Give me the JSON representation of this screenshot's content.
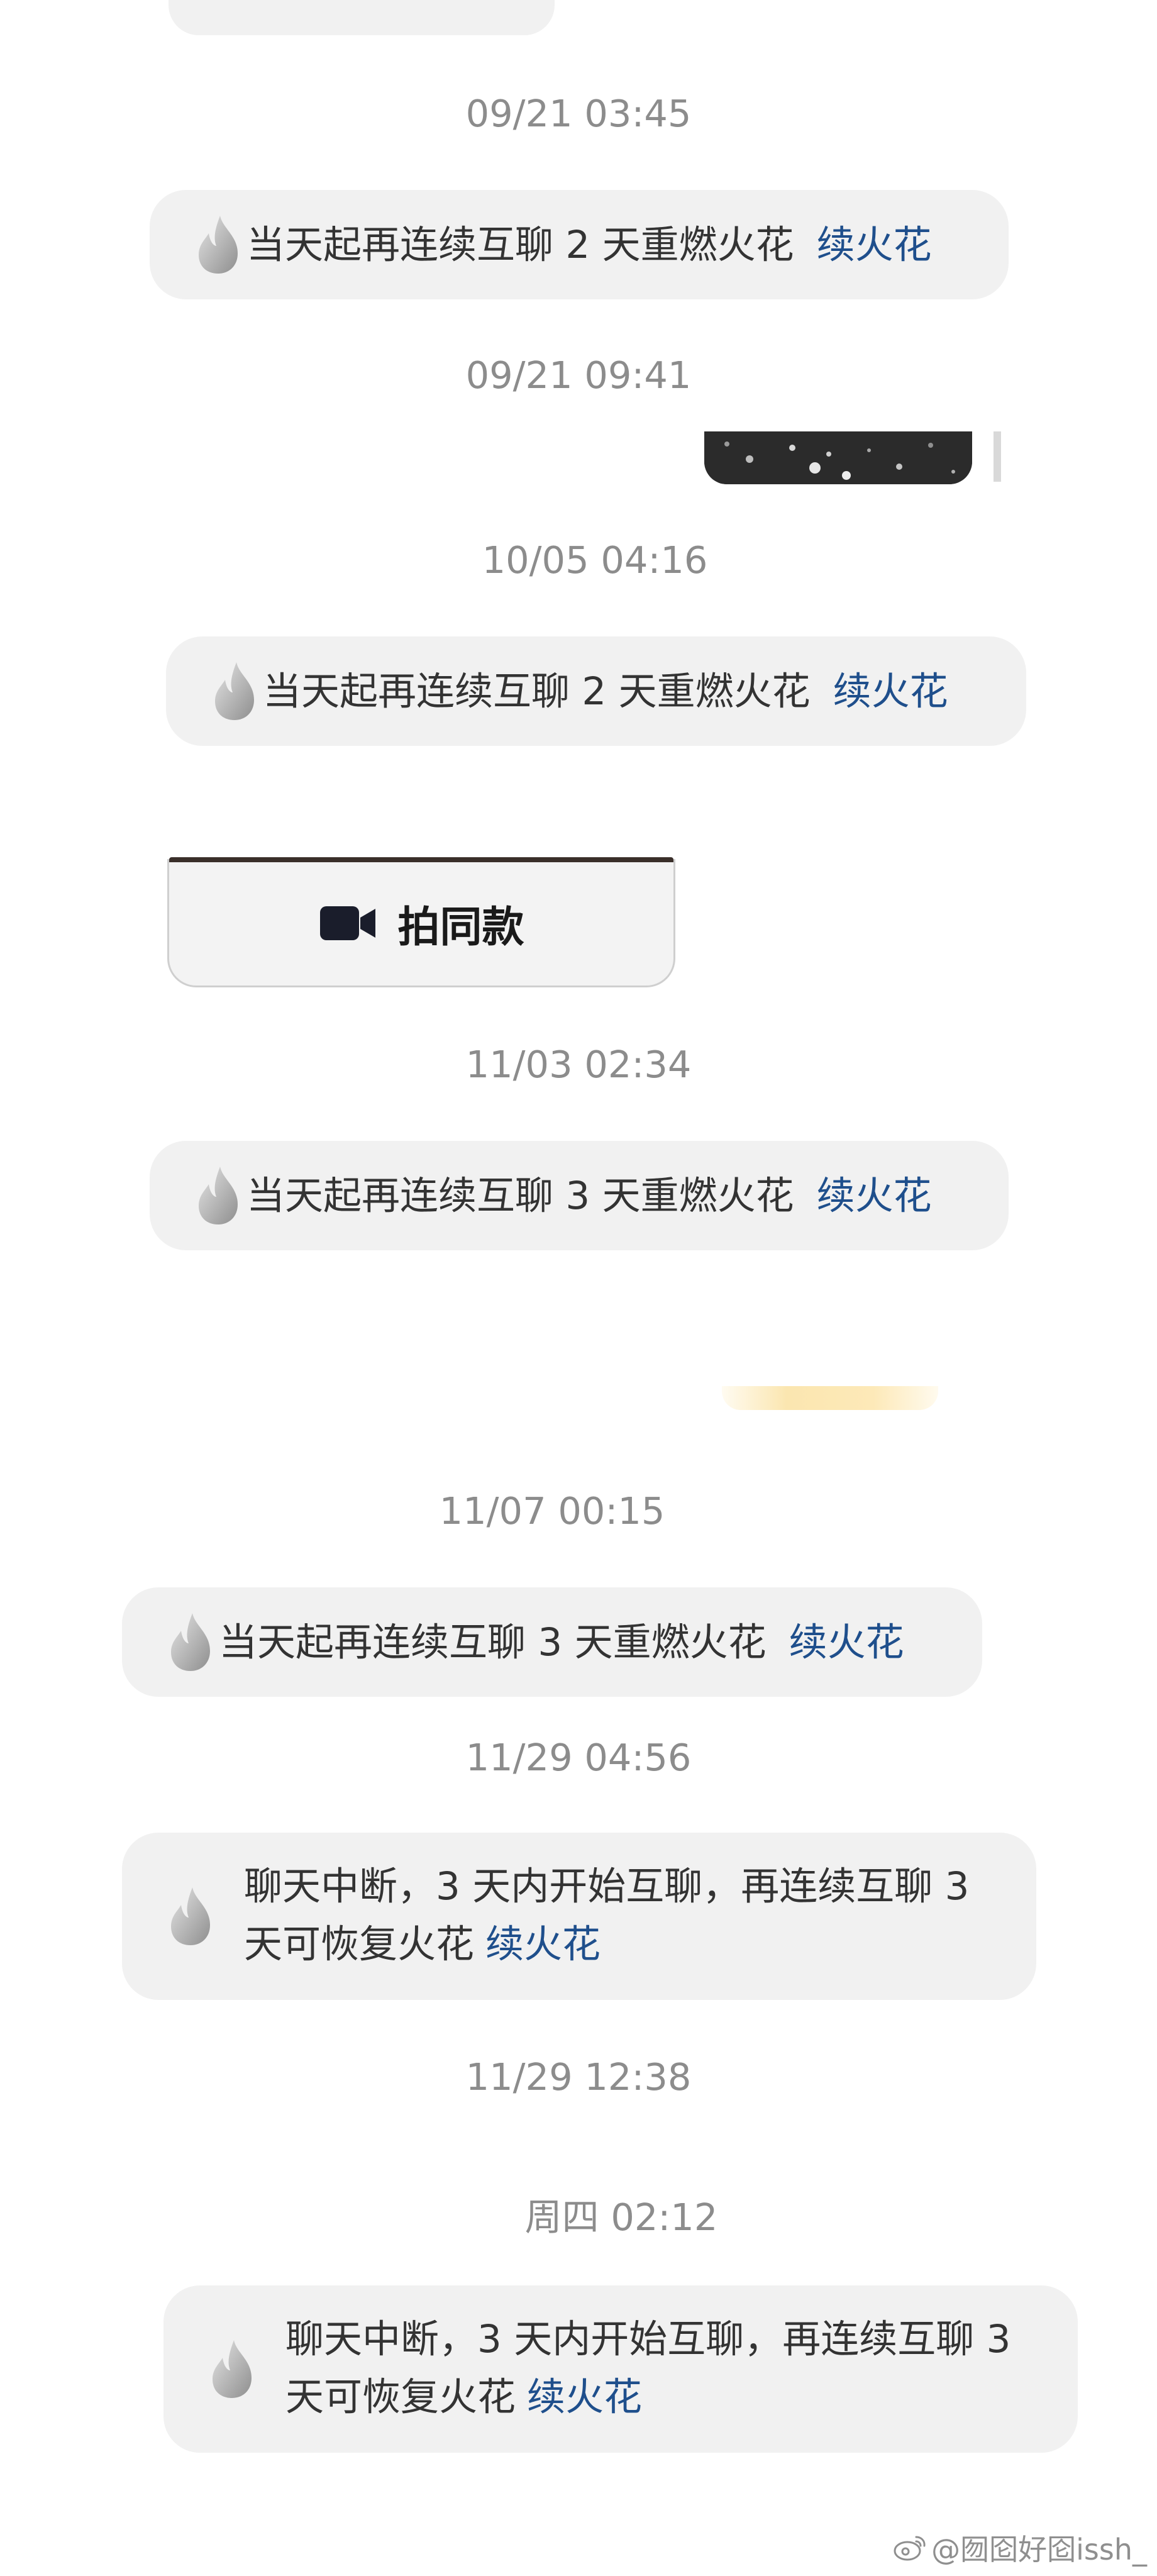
{
  "messages": [
    {
      "timestamp": "09/21 03:45",
      "notice": "当天起再连续互聊 2 天重燃火花",
      "action": "续火花"
    },
    {
      "timestamp": "09/21 09:41"
    },
    {
      "timestamp": "10/05 04:16",
      "notice": "当天起再连续互聊 2 天重燃火花",
      "action": "续火花"
    },
    {
      "same_style_button": "拍同款"
    },
    {
      "timestamp": "11/03 02:34",
      "notice": "当天起再连续互聊 3 天重燃火花",
      "action": "续火花"
    },
    {
      "timestamp": "11/07 00:15",
      "notice": "当天起再连续互聊 3 天重燃火花",
      "action": "续火花"
    },
    {
      "timestamp": "11/29 04:56",
      "notice_line1": "聊天中断，3 天内开始互聊，再连续互聊 3",
      "notice_line2": "天可恢复火花",
      "action": "续火花"
    },
    {
      "timestamp": "11/29 12:38"
    },
    {
      "timestamp": "周四 02:12",
      "notice_line1": "聊天中断，3 天内开始互聊，再连续互聊 3",
      "notice_line2": "天可恢复火花",
      "action": "续火花"
    }
  ],
  "watermark": "@囫囵好囵issh_",
  "icons": {
    "flame": "flame-icon",
    "video": "video-camera-icon",
    "weibo": "weibo-logo-icon"
  },
  "colors": {
    "bubble_bg": "#f1f1f1",
    "timestamp": "#8c8c8c",
    "link": "#1f4f8c",
    "text": "#333333",
    "flame": "#bdbdbd"
  }
}
